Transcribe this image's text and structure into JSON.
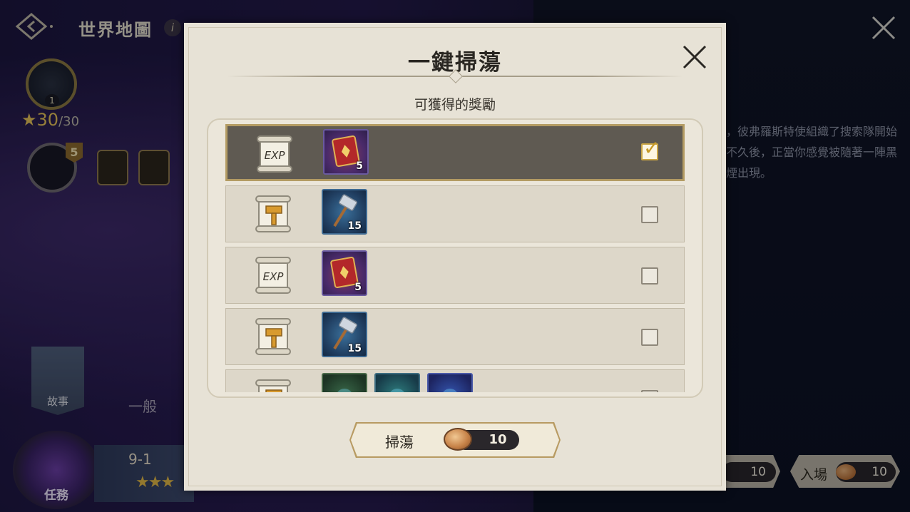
{
  "background": {
    "title": "世界地圖",
    "info_icon": "i",
    "crystal_level": "1",
    "stars": "★30",
    "stars_max": "/30",
    "rank_badge": "5",
    "story_label": "故事",
    "tab_normal": "一般",
    "quest_label": "任務",
    "stage": "9-1",
    "stage_stars": "★★★",
    "story_text": "，彼弗羅斯特使組織了搜索隊開始不久後，正當你感覺被隨著一陣黑煙出現。",
    "enter_label": "入場",
    "enter_cost": "10",
    "enter_cost_2": "10"
  },
  "modal": {
    "title": "一鍵掃蕩",
    "subtitle": "可獲得的獎勵",
    "rows": [
      {
        "scroll": "exp-scroll-icon",
        "items": [
          {
            "icon": "exp-book-icon",
            "count": "5"
          }
        ],
        "checked": true
      },
      {
        "scroll": "hammer-scroll-icon",
        "items": [
          {
            "icon": "hammer-icon",
            "count": "15"
          }
        ],
        "checked": false
      },
      {
        "scroll": "exp-scroll-icon",
        "items": [
          {
            "icon": "exp-book-icon",
            "count": "5"
          }
        ],
        "checked": false
      },
      {
        "scroll": "hammer-scroll-icon",
        "items": [
          {
            "icon": "hammer-icon",
            "count": "15"
          }
        ],
        "checked": false
      },
      {
        "scroll": "hammer-scroll-icon",
        "items": [
          {
            "icon": "green-rune-icon",
            "count": ""
          },
          {
            "icon": "teal-rune-icon",
            "count": ""
          },
          {
            "icon": "blue-rune-icon",
            "count": ""
          }
        ],
        "checked": false
      }
    ],
    "sweep_button": {
      "label": "掃蕩",
      "cost": "10",
      "cost_icon": "bread-icon"
    }
  },
  "colors": {
    "modal_bg": "#e7e2d6",
    "selected_row": "#5f5a52",
    "check_gold": "#c79a27",
    "button_border": "#b89b62"
  }
}
